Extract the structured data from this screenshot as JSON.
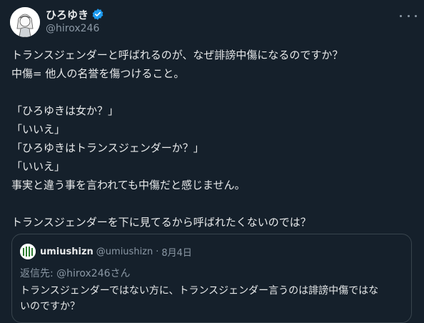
{
  "author": {
    "display_name": "ひろゆき",
    "handle": "@hirox246"
  },
  "tweet_lines": [
    "トランスジェンダーと呼ばれるのが、なぜ誹謗中傷になるのですか？",
    "中傷= 他人の名誉を傷つけること。",
    "",
    "「ひろゆきは女か？」",
    "「いいえ」",
    "「ひろゆきはトランスジェンダーか？」",
    "「いいえ」",
    "事実と違う事を言われても中傷だと感じません。",
    "",
    "トランスジェンダーを下に見てるから呼ばれたくないのでは？"
  ],
  "quoted": {
    "display_name": "umiushizn",
    "handle": "@umiushizn",
    "separator": "·",
    "date": "8月4日",
    "reply_to": "返信先: @hirox246さん",
    "text_lines": [
      "トランスジェンダーではない方に、トランスジェンダー言うのは誹謗中傷ではな",
      "いのですか？"
    ]
  },
  "icons": {
    "verified": "verified-badge-icon",
    "more": "more-options-icon"
  },
  "colors": {
    "background": "#15202b",
    "text": "#e7e9ea",
    "secondary": "#8b98a5",
    "verified": "#1d9bf0",
    "border": "#38444d"
  }
}
